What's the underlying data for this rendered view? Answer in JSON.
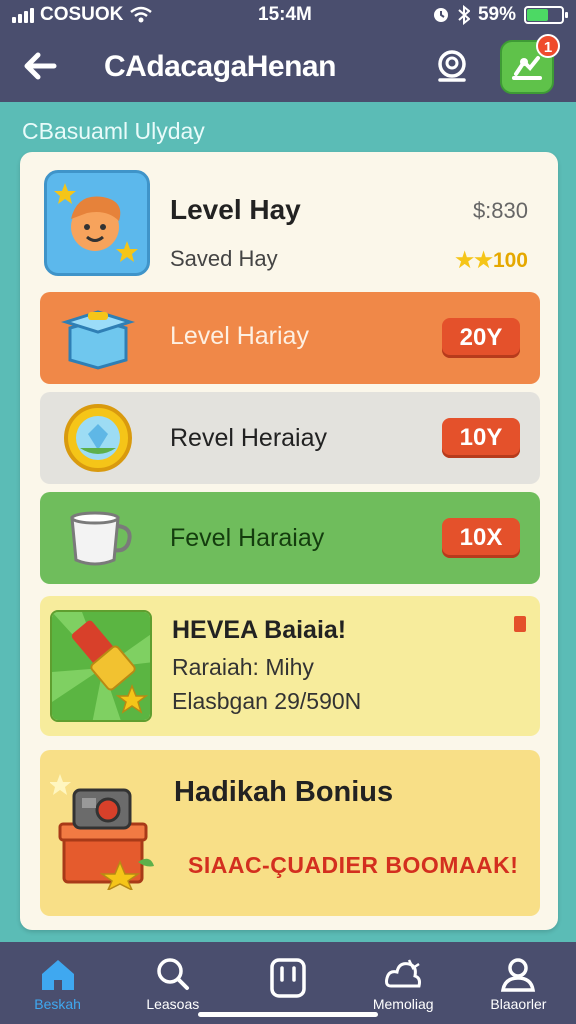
{
  "status_bar": {
    "carrier": "COSUOK",
    "time": "15:4M",
    "battery": "59%",
    "battery_level": 0.59
  },
  "header": {
    "title": "CAdacagaHenan",
    "cart_badge": "1"
  },
  "section_label": "CBasuaml Ulyday",
  "top_card": {
    "title": "Level Hay",
    "subtitle": "Saved Hay",
    "price": "$:830",
    "stars": "100"
  },
  "rows": [
    {
      "label": "Level Hariay",
      "badge": "20Y"
    },
    {
      "label": "Revel Heraiay",
      "badge": "10Y"
    },
    {
      "label": "Fevel Haraiay",
      "badge": "10X"
    }
  ],
  "promo": {
    "title": "HEVEA Baiaia!",
    "line1": "Raraiah: Mihy",
    "line2": "Elasbgan 29/590N"
  },
  "bonus": {
    "title": "Hadikah Bonius",
    "cta": "SIAAC-ÇUADIER BOOMAAK!"
  },
  "nav": [
    {
      "label": "Beskah",
      "icon": "home-icon"
    },
    {
      "label": "Leasoas",
      "icon": "search-icon"
    },
    {
      "label": "",
      "icon": "bag-icon"
    },
    {
      "label": "Memoliag",
      "icon": "cloud-bell-icon"
    },
    {
      "label": "Blaaorler",
      "icon": "user-icon"
    }
  ],
  "colors": {
    "header": "#4a4e6e",
    "background": "#5bbcb6",
    "accent_orange": "#f08848",
    "accent_green": "#6fbd5c",
    "badge_red": "#e4512b",
    "nav_active": "#3fa8f0"
  }
}
